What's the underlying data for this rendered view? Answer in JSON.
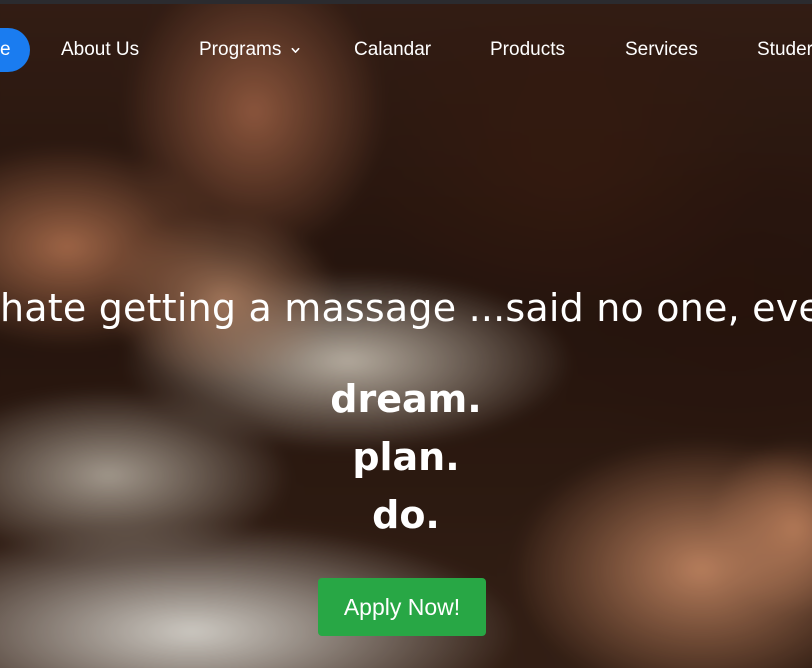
{
  "nav": {
    "home_label": "e",
    "items": [
      {
        "label": "About Us"
      },
      {
        "label": "Programs"
      },
      {
        "label": "Calandar"
      },
      {
        "label": "Products"
      },
      {
        "label": "Services"
      },
      {
        "label": "Studer"
      }
    ],
    "programs_icon": "chevron-down-icon",
    "accent": "#1a7cf0"
  },
  "hero": {
    "tagline": "hate getting a massage ...said no one, ever.",
    "motto": [
      "dream.",
      "plan.",
      "do."
    ],
    "cta_label": "Apply Now!",
    "cta_color": "#28a745"
  }
}
